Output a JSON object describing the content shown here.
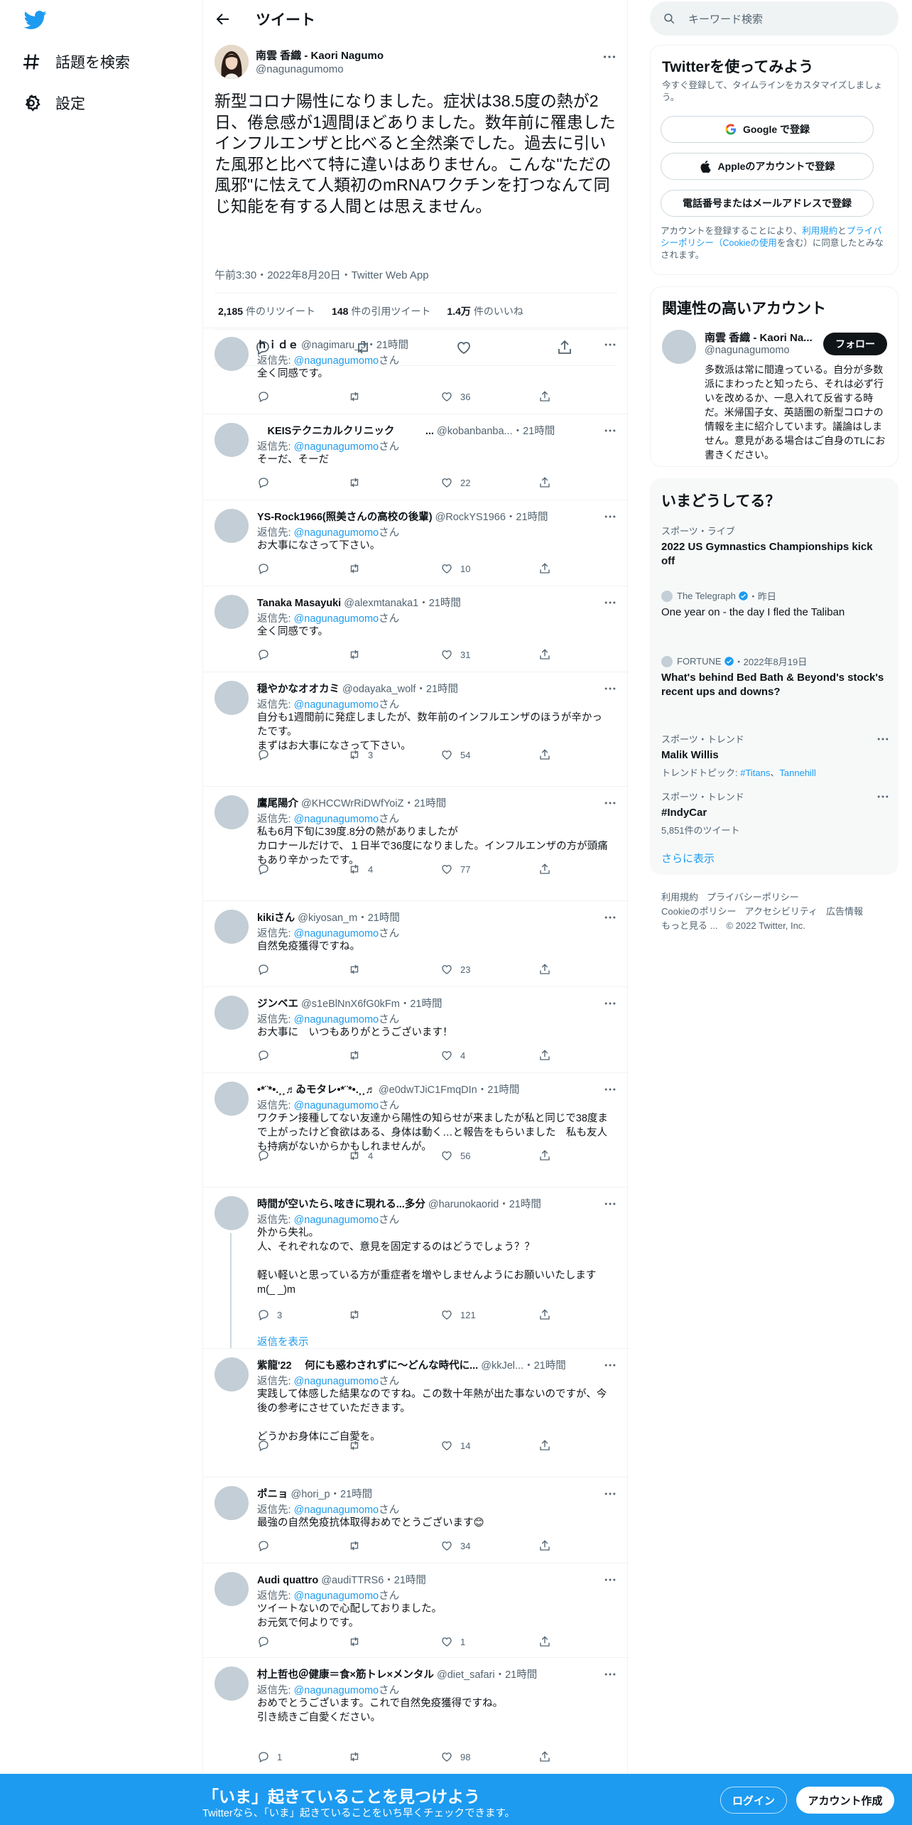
{
  "nav": {
    "explore_label": "話題を検索",
    "settings_label": "設定"
  },
  "header": {
    "title": "ツイート"
  },
  "focal": {
    "name": "南雲 香織 - Kaori Nagumo",
    "handle": "@nagunagumomo",
    "text": "新型コロナ陽性になりました。症状は38.5度の熱が2日、倦怠感が1週間ほどありました。数年前に罹患したインフルエンザと比べると全然楽でした。過去に引いた風邪と比べて特に違いはありません。こんな\"ただの風邪\"に怯えて人類初のmRNAワクチンを打つなんて同じ知能を有する人間とは思えません。",
    "timestamp": "午前3:30・2022年8月20日・Twitter Web App",
    "retweets": "2,185",
    "retweets_label": "件のリツイート",
    "quotes": "148",
    "quotes_label": "件の引用ツイート",
    "likes": "1.4万",
    "likes_label": "件のいいね"
  },
  "replies": [
    {
      "name": "ｈｉｄｅ",
      "meta": "@nagimaru_5・21時間",
      "to_label": "返信先: ",
      "to": "@nagunagumomo",
      "to_suffix": "さん",
      "body": "全く同感です。",
      "retweets": "",
      "likes": "36"
    },
    {
      "name": "　KEISテクニカルクリニック　　　...",
      "meta": "@kobanbanba...・21時間",
      "to_label": "返信先: ",
      "to": "@nagunagumomo",
      "to_suffix": "さん",
      "body": "そーだ、そーだ",
      "retweets": "",
      "likes": "22"
    },
    {
      "name": "YS-Rock1966(照美さんの高校の後輩)",
      "meta": "@RockYS1966・21時間",
      "to_label": "返信先: ",
      "to": "@nagunagumomo",
      "to_suffix": "さん",
      "body": "お大事になさって下さい。",
      "retweets": "",
      "likes": "10"
    },
    {
      "name": "Tanaka Masayuki",
      "meta": "@alexmtanaka1・21時間",
      "to_label": "返信先: ",
      "to": "@nagunagumomo",
      "to_suffix": "さん",
      "body": "全く同感です。",
      "retweets": "",
      "likes": "31"
    },
    {
      "name": "穏やかなオオカミ",
      "meta": "@odayaka_wolf・21時間",
      "to_label": "返信先: ",
      "to": "@nagunagumomo",
      "to_suffix": "さん",
      "body": "自分も1週間前に発症しましたが、数年前のインフルエンザのほうが辛かったです。\nまずはお大事になさって下さい。",
      "retweets": "3",
      "likes": "54"
    },
    {
      "name": "鷹尾陽介",
      "meta": "@KHCCWrRiDWfYoiZ・21時間",
      "to_label": "返信先: ",
      "to": "@nagunagumomo",
      "to_suffix": "さん",
      "body": "私も6月下旬に39度.8分の熱がありましたが\nカロナールだけで、１日半で36度になりました。インフルエンザの方が頭痛もあり辛かったです。",
      "retweets": "4",
      "likes": "77"
    },
    {
      "name": "kikiさん",
      "meta": "@kiyosan_m・21時間",
      "to_label": "返信先: ",
      "to": "@nagunagumomo",
      "to_suffix": "さん",
      "body": "自然免疫獲得ですね。",
      "retweets": "",
      "likes": "23"
    },
    {
      "name": "ジンベエ",
      "meta": "@s1eBlNnX6fG0kFm・21時間",
      "to_label": "返信先: ",
      "to": "@nagunagumomo",
      "to_suffix": "さん",
      "body": "お大事に　いつもありがとうございます！",
      "retweets": "",
      "likes": "4"
    },
    {
      "name": "•*¨*•.¸¸♬ゐモタレ•*¨*•.¸¸♬",
      "meta": "@e0dwTJiC1FmqDIn・21時間",
      "to_label": "返信先: ",
      "to": "@nagunagumomo",
      "to_suffix": "さん",
      "body": "ワクチン接種してない友達から陽性の知らせが来ましたが私と同じで38度まで上がったけど食欲はある、身体は動く…と報告をもらいました　私も友人も持病がないからかもしれませんが。",
      "retweets": "4",
      "likes": "56"
    },
    {
      "name": "時間が空いたら､呟きに現れる...多分",
      "meta": "@harunokaorid・21時間",
      "to_label": "返信先: ",
      "to": "@nagunagumomo",
      "to_suffix": "さん",
      "body": "外から失礼。\n人、それぞれなので、意見を固定するのはどうでしょう？？\n\n軽い軽いと思っている方が重症者を増やしませんようにお願いいたします m(_ _)m",
      "replies": "3",
      "retweets": "",
      "likes": "121",
      "show_replies": "返信を表示"
    },
    {
      "name": "紫龍'22　 何にも惑わされずに〜どんな時代に...",
      "meta": "@kkJel...・21時間",
      "to_label": "返信先: ",
      "to": "@nagunagumomo",
      "to_suffix": "さん",
      "body": "実践して体感した結果なのですね。この数十年熱が出た事ないのですが、今後の参考にさせていただきます。\n\nどうかお身体にご自愛を。",
      "retweets": "",
      "likes": "14"
    },
    {
      "name": "ポニョ",
      "meta": "@hori_p・21時間",
      "to_label": "返信先: ",
      "to": "@nagunagumomo",
      "to_suffix": "さん",
      "body": "最強の自然免疫抗体取得おめでとうございます😊",
      "retweets": "",
      "likes": "34"
    },
    {
      "name": "Audi quattro",
      "meta": "@audiTTRS6・21時間",
      "to_label": "返信先: ",
      "to": "@nagunagumomo",
      "to_suffix": "さん",
      "body": "ツイートないので心配しておりました。\nお元気で何よりです。",
      "retweets": "",
      "likes": "1"
    },
    {
      "name": "村上哲也＠健康＝食×筋トレ×メンタル",
      "meta": "@diet_safari・21時間",
      "to_label": "返信先: ",
      "to": "@nagunagumomo",
      "to_suffix": "さん",
      "body": "おめでとうございます。これで自然免疫獲得ですね。\n引き続きご自愛ください。",
      "replies": "1",
      "retweets": "",
      "likes": "98"
    }
  ],
  "search": {
    "placeholder": "キーワード検索"
  },
  "signup": {
    "title": "Twitterを使ってみよう",
    "subtitle": "今すぐ登録して、タイムラインをカスタマイズしましょう。",
    "google": "Google で登録",
    "apple": "Appleのアカウントで登録",
    "phone": "電話番号またはメールアドレスで登録",
    "terms_pre": "アカウントを登録することにより、",
    "terms_link1": "利用規約",
    "terms_mid": "と",
    "terms_link2": "プライバシーポリシー（Cookieの使用",
    "terms_post": "を含む）に同意したとみなされます。"
  },
  "relevant": {
    "title": "関連性の高いアカウント",
    "name": "南雲 香織 - Kaori Na...",
    "handle": "@nagunagumomo",
    "follow": "フォロー",
    "bio": "多数派は常に間違っている。自分が多数派にまわったと知ったら、それは必ず行いを改めるか、一息入れて反省する時だ。米帰国子女、英語圏の新型コロナの情報を主に紹介しています。議論はしません。意見がある場合はご自身のTLにお書きください。"
  },
  "trends": {
    "title": "いまどうしてる？",
    "items": [
      {
        "category": "スポーツ・ライブ",
        "title": "2022 US Gymnastics Championships kick off"
      },
      {
        "source": "The Telegraph",
        "when": "・昨日",
        "title": "One year on - the day I fled the Taliban"
      },
      {
        "source": "FORTUNE",
        "when": "・2022年8月19日",
        "title": "What's behind Bed Bath & Beyond's stock's recent ups and downs?"
      },
      {
        "category": "スポーツ・トレンド",
        "title": "Malik Willis",
        "meta_pre": "トレンドトピック: ",
        "meta_link1": "#Titans",
        "meta_sep": "、",
        "meta_link2": "Tannehill"
      },
      {
        "category": "スポーツ・トレンド",
        "title": "#IndyCar",
        "meta": "5,851件のツイート"
      }
    ],
    "more": "さらに表示"
  },
  "footer": {
    "links": [
      "利用規約",
      "プライバシーポリシー",
      "Cookieのポリシー",
      "アクセシビリティ",
      "広告情報",
      "もっと見る ...",
      "© 2022 Twitter, Inc."
    ]
  },
  "banner": {
    "title": "「いま」起きていることを見つけよう",
    "subtitle": "Twitterなら、「いま」起きていることをいち早くチェックできます。",
    "login": "ログイン",
    "signup": "アカウント作成"
  },
  "colors": {
    "accent": "#1d9bf0",
    "text": "#0f1419",
    "muted": "#536471",
    "border": "#eff3f4"
  }
}
